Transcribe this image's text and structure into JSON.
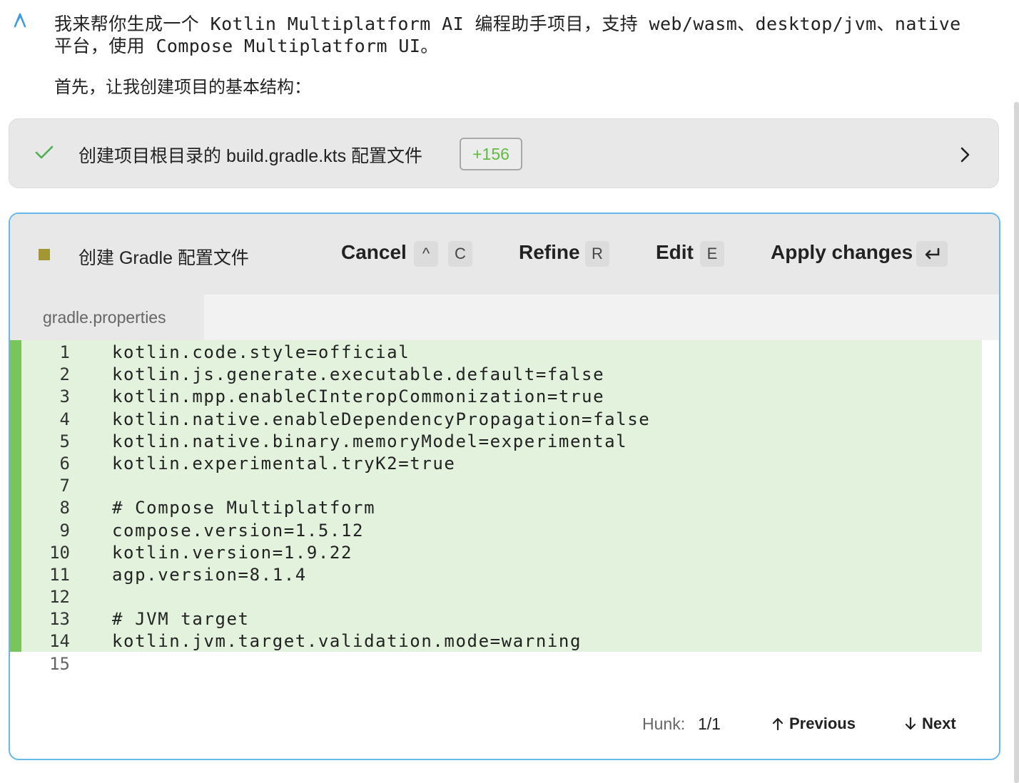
{
  "message": {
    "line1": "我来帮你生成一个 Kotlin Multiplatform AI 编程助手项目，支持 web/wasm、desktop/jvm、native",
    "line2": "平台，使用 Compose Multiplatform UI。",
    "subtext": "首先，让我创建项目的基本结构："
  },
  "step": {
    "title": "创建项目根目录的 build.gradle.kts 配置文件",
    "badge": "+156",
    "status": "completed"
  },
  "diff": {
    "title": "创建 Gradle 配置文件",
    "actions": {
      "cancel": "Cancel",
      "cancel_key1": "^",
      "cancel_key2": "C",
      "refine": "Refine",
      "refine_key": "R",
      "edit": "Edit",
      "edit_key": "E",
      "apply": "Apply changes"
    },
    "tab": "gradle.properties",
    "lines": [
      {
        "n": "1",
        "text": "kotlin.code.style=official",
        "added": true
      },
      {
        "n": "2",
        "text": "kotlin.js.generate.executable.default=false",
        "added": true
      },
      {
        "n": "3",
        "text": "kotlin.mpp.enableCInteropCommonization=true",
        "added": true
      },
      {
        "n": "4",
        "text": "kotlin.native.enableDependencyPropagation=false",
        "added": true
      },
      {
        "n": "5",
        "text": "kotlin.native.binary.memoryModel=experimental",
        "added": true
      },
      {
        "n": "6",
        "text": "kotlin.experimental.tryK2=true",
        "added": true
      },
      {
        "n": "7",
        "text": "",
        "added": true
      },
      {
        "n": "8",
        "text": "# Compose Multiplatform",
        "added": true
      },
      {
        "n": "9",
        "text": "compose.version=1.5.12",
        "added": true
      },
      {
        "n": "10",
        "text": "kotlin.version=1.9.22",
        "added": true
      },
      {
        "n": "11",
        "text": "agp.version=8.1.4",
        "added": true
      },
      {
        "n": "12",
        "text": "",
        "added": true
      },
      {
        "n": "13",
        "text": "# JVM target",
        "added": true
      },
      {
        "n": "14",
        "text": "kotlin.jvm.target.validation.mode=warning",
        "added": true
      },
      {
        "n": "15",
        "text": "",
        "added": false
      }
    ],
    "hunk": {
      "label": "Hunk:",
      "value": "1/1",
      "previous": "Previous",
      "next": "Next"
    }
  },
  "colors": {
    "accent_border": "#68b8ea",
    "added_bg": "#e2f2dc",
    "added_bar": "#78c55c",
    "badge_text": "#5fbb3d",
    "check": "#4caf50",
    "pending_square": "#a39734"
  }
}
